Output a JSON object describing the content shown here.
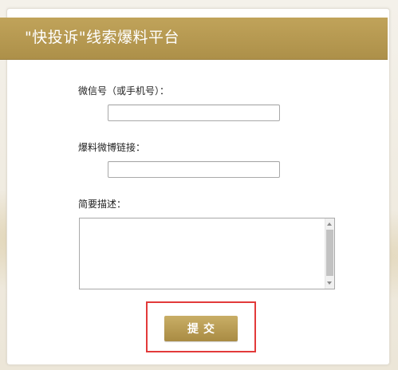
{
  "header": {
    "title": "\"快投诉\"线索爆料平台"
  },
  "form": {
    "wechat_label": "微信号（或手机号）：",
    "wechat_value": "",
    "weibo_label": "爆料微博链接：",
    "weibo_value": "",
    "description_label": "简要描述：",
    "description_value": "",
    "submit_label": "提交"
  },
  "colors": {
    "header_gold": "#b69a51",
    "button_gold": "#b79a52",
    "highlight_red": "#e23a3a"
  }
}
